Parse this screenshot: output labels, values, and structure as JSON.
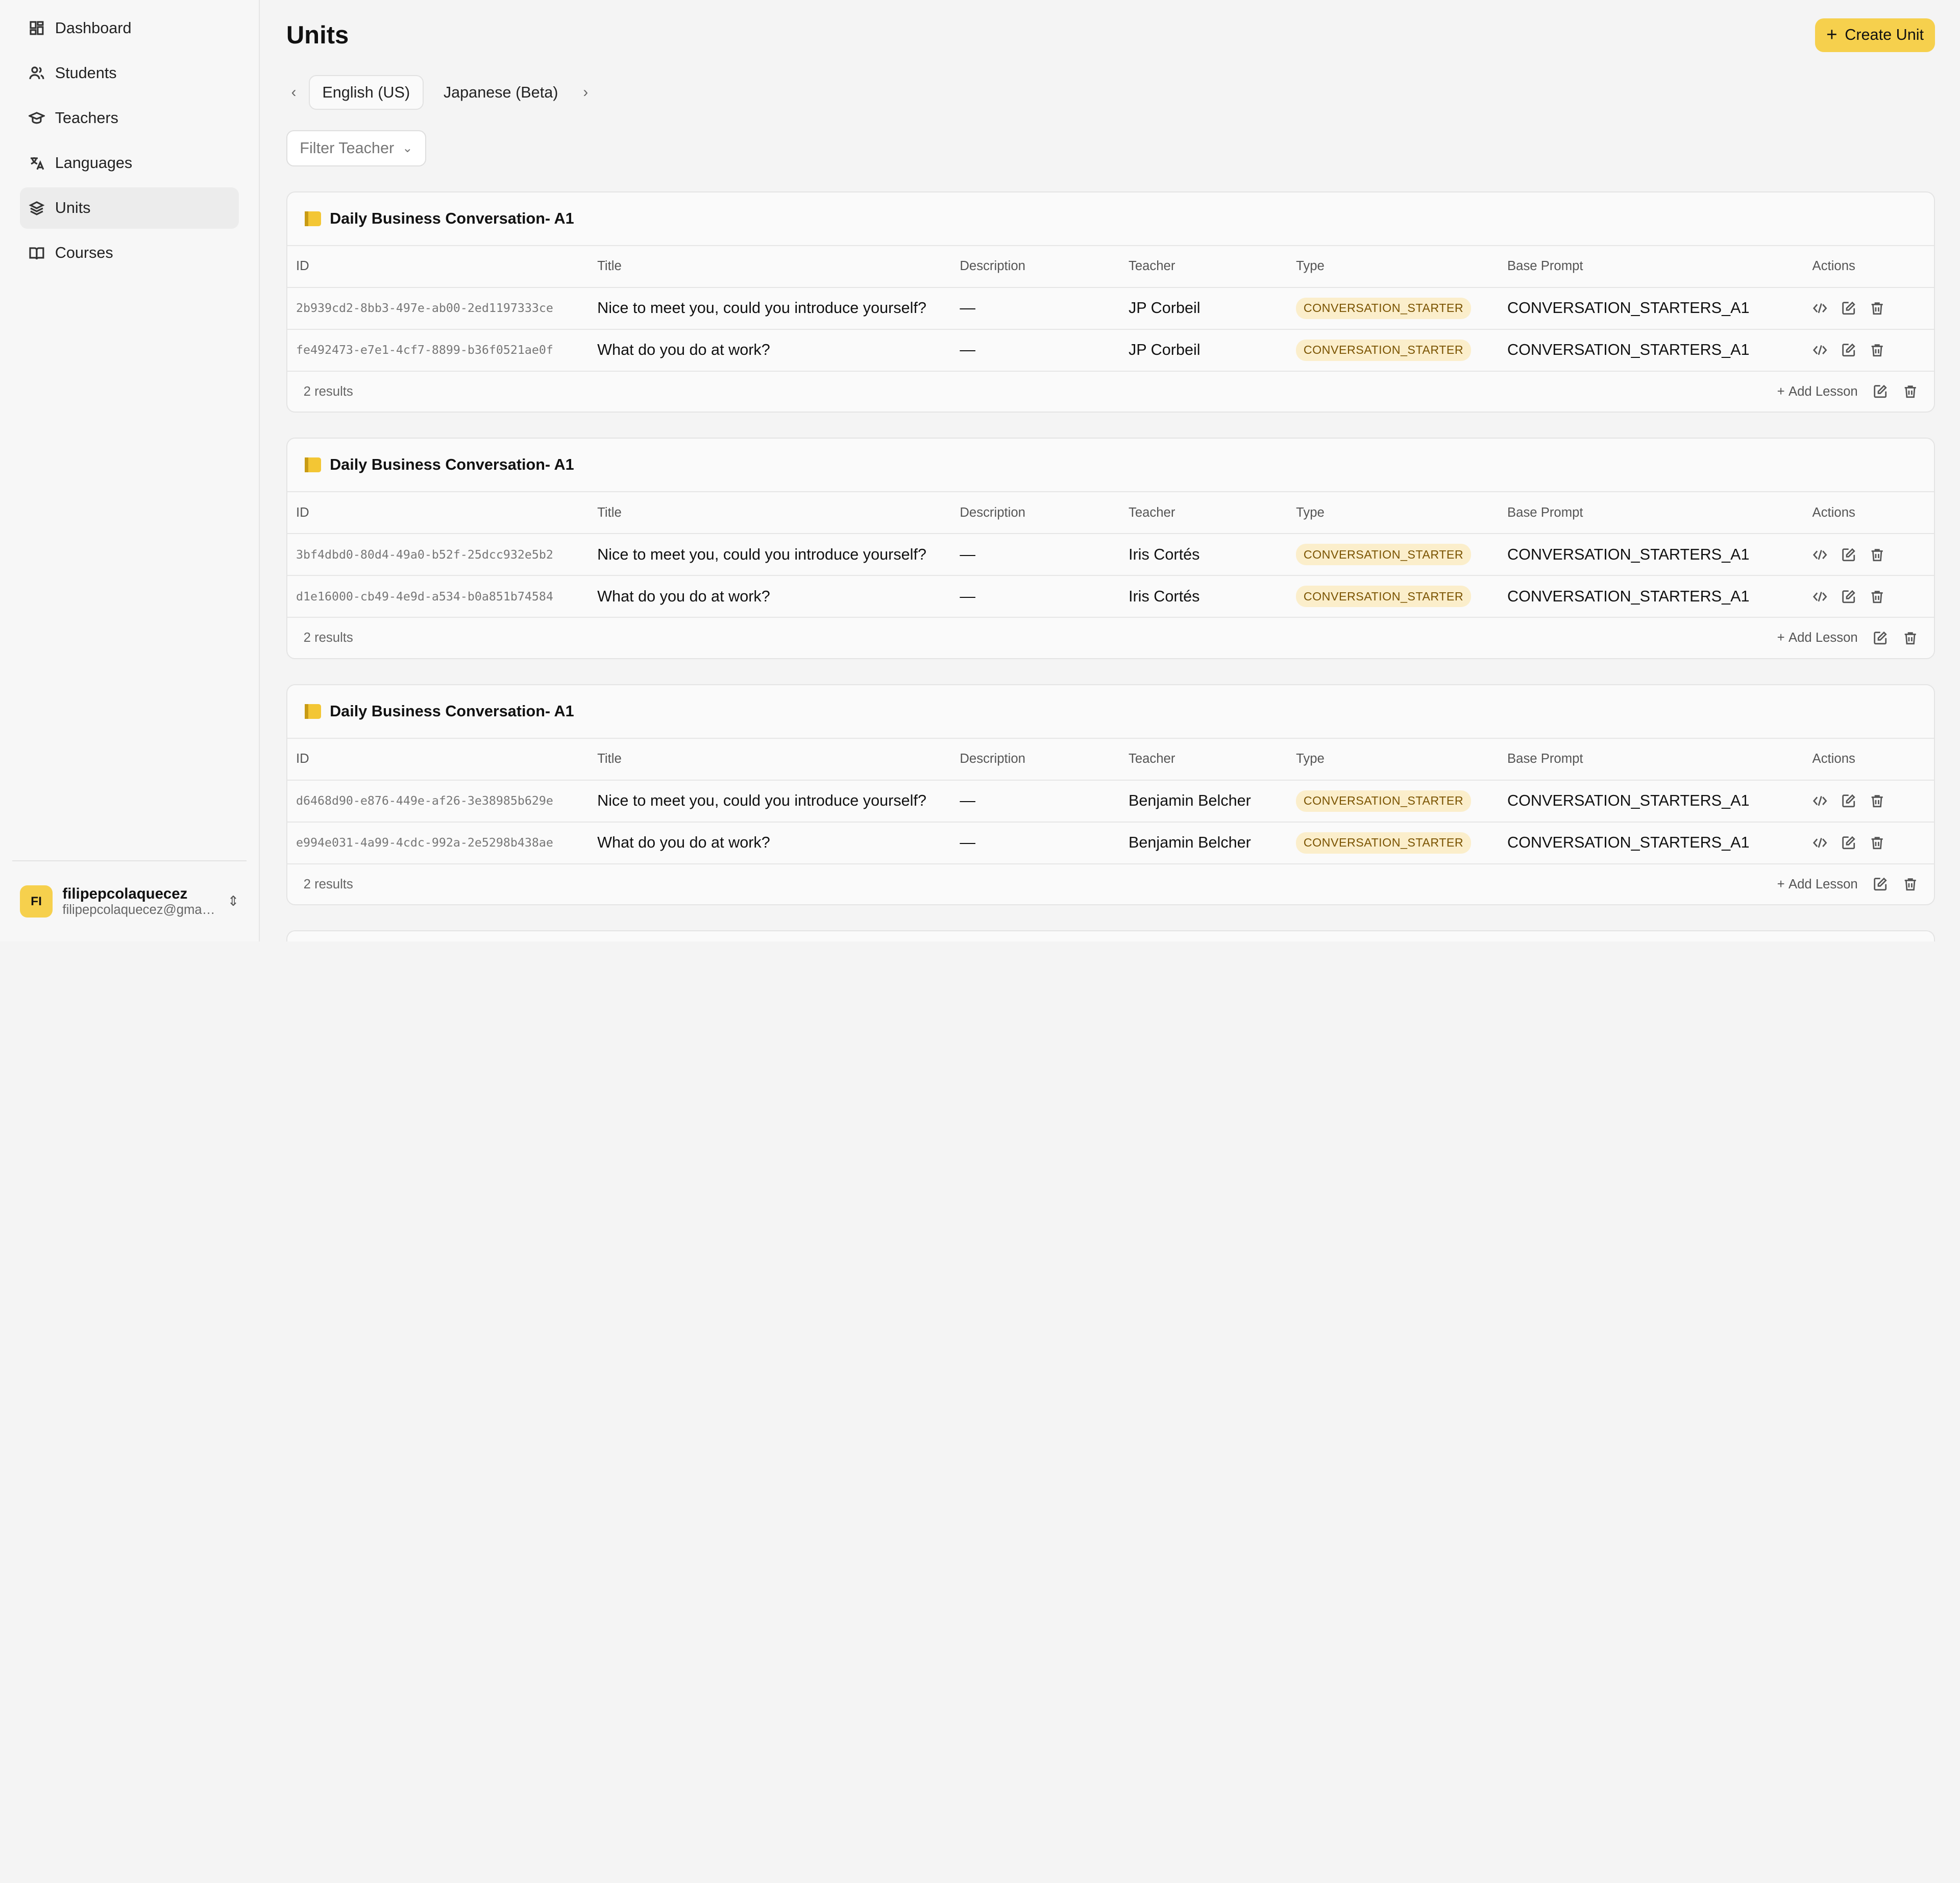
{
  "sidebar": {
    "items": [
      {
        "label": "Dashboard",
        "icon": "dashboard-icon"
      },
      {
        "label": "Students",
        "icon": "users-icon"
      },
      {
        "label": "Teachers",
        "icon": "graduation-cap-icon"
      },
      {
        "label": "Languages",
        "icon": "translate-icon"
      },
      {
        "label": "Units",
        "icon": "layers-icon",
        "active": true
      },
      {
        "label": "Courses",
        "icon": "book-icon"
      }
    ],
    "user": {
      "initials": "FI",
      "name": "filipepcolaquecez",
      "email": "filipepcolaquecez@gmail..."
    }
  },
  "header": {
    "title": "Units",
    "create_label": "Create Unit"
  },
  "language_tabs": [
    "English (US)",
    "Japanese (Beta)"
  ],
  "filter": {
    "placeholder": "Filter Teacher"
  },
  "columns": [
    "ID",
    "Title",
    "Description",
    "Teacher",
    "Type",
    "Base Prompt",
    "Actions"
  ],
  "units": [
    {
      "name": "Daily Business Conversation- A1",
      "results": "2 results",
      "add_label": "Add Lesson",
      "rows": [
        {
          "id": "2b939cd2-8bb3-497e-ab00-2ed1197333ce",
          "title": "Nice to meet you, could you introduce yourself?",
          "description": "—",
          "teacher": "JP Corbeil",
          "type": "CONVERSATION_STARTER",
          "prompt": "CONVERSATION_STARTERS_A1"
        },
        {
          "id": "fe492473-e7e1-4cf7-8899-b36f0521ae0f",
          "title": "What do you do at work?",
          "description": "—",
          "teacher": "JP Corbeil",
          "type": "CONVERSATION_STARTER",
          "prompt": "CONVERSATION_STARTERS_A1"
        }
      ]
    },
    {
      "name": "Daily Business Conversation- A1",
      "results": "2 results",
      "add_label": "Add Lesson",
      "rows": [
        {
          "id": "3bf4dbd0-80d4-49a0-b52f-25dcc932e5b2",
          "title": "Nice to meet you, could you introduce yourself?",
          "description": "—",
          "teacher": "Iris Cortés",
          "type": "CONVERSATION_STARTER",
          "prompt": "CONVERSATION_STARTERS_A1"
        },
        {
          "id": "d1e16000-cb49-4e9d-a534-b0a851b74584",
          "title": "What do you do at work?",
          "description": "—",
          "teacher": "Iris Cortés",
          "type": "CONVERSATION_STARTER",
          "prompt": "CONVERSATION_STARTERS_A1"
        }
      ]
    },
    {
      "name": "Daily Business Conversation- A1",
      "results": "2 results",
      "add_label": "Add Lesson",
      "rows": [
        {
          "id": "d6468d90-e876-449e-af26-3e38985b629e",
          "title": "Nice to meet you, could you introduce yourself?",
          "description": "—",
          "teacher": "Benjamin Belcher",
          "type": "CONVERSATION_STARTER",
          "prompt": "CONVERSATION_STARTERS_A1"
        },
        {
          "id": "e994e031-4a99-4cdc-992a-2e5298b438ae",
          "title": "What do you do at work?",
          "description": "—",
          "teacher": "Benjamin Belcher",
          "type": "CONVERSATION_STARTER",
          "prompt": "CONVERSATION_STARTERS_A1"
        }
      ]
    }
  ],
  "colors": {
    "accent": "#f6d04d",
    "badge_bg": "#fbeecb",
    "badge_text": "#7a5300"
  }
}
